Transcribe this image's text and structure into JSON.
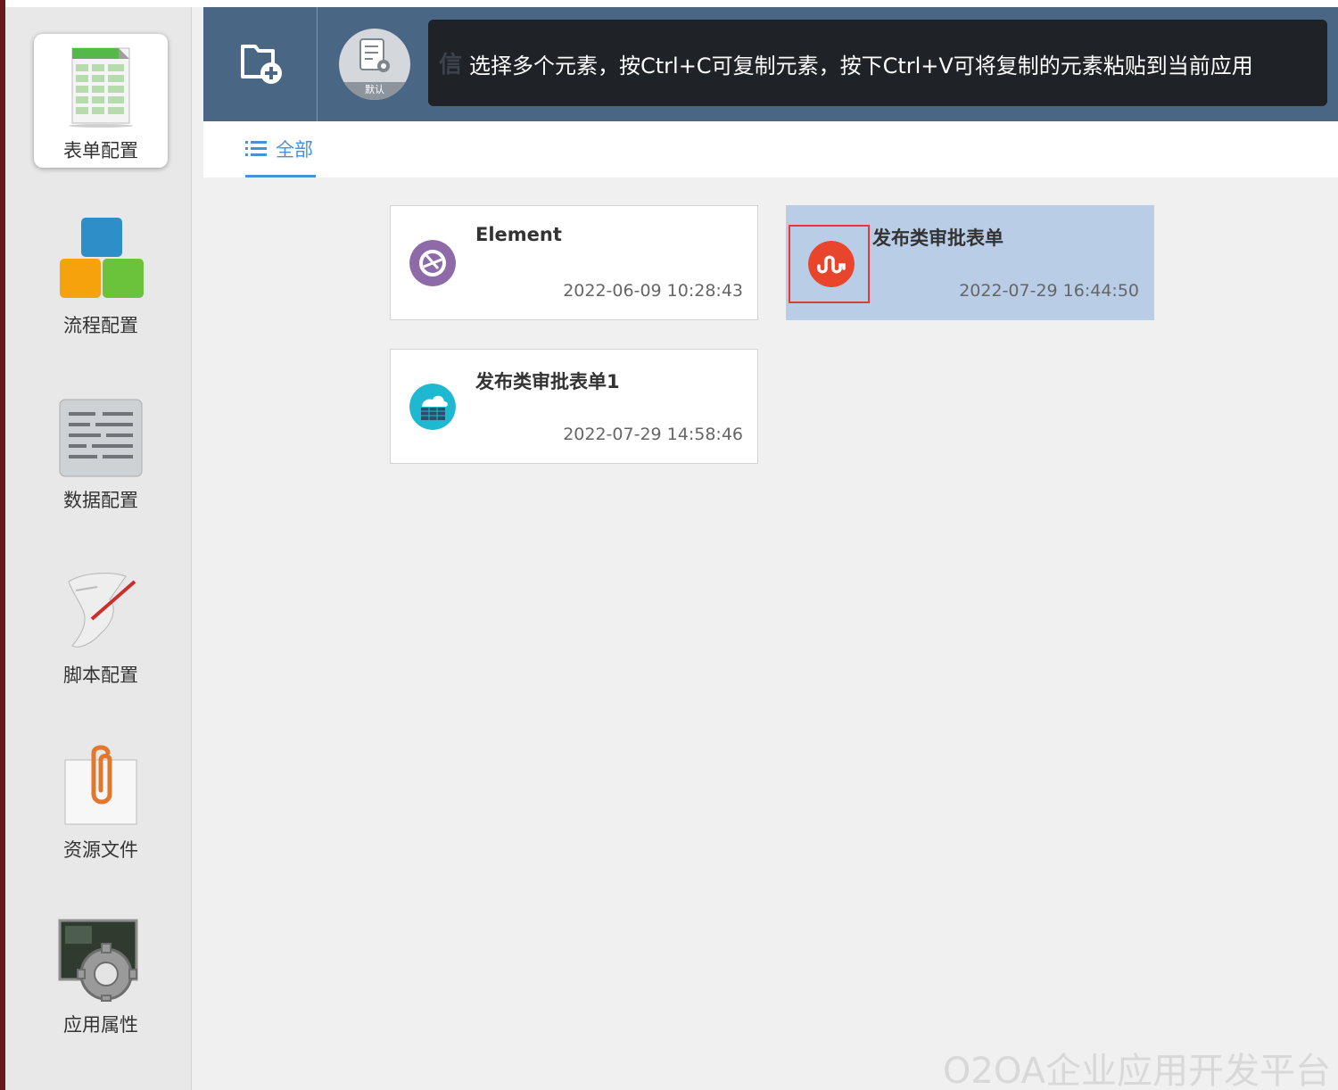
{
  "sidebar": {
    "items": [
      {
        "label": "表单配置",
        "icon": "form-spreadsheet-icon",
        "active": true
      },
      {
        "label": "流程配置",
        "icon": "process-blocks-icon",
        "active": false
      },
      {
        "label": "数据配置",
        "icon": "data-keyboard-icon",
        "active": false
      },
      {
        "label": "脚本配置",
        "icon": "script-scroll-icon",
        "active": false
      },
      {
        "label": "资源文件",
        "icon": "paperclip-file-icon",
        "active": false
      },
      {
        "label": "应用属性",
        "icon": "gear-settings-icon",
        "active": false
      }
    ]
  },
  "topbar": {
    "add_icon": "add-folder-icon",
    "default_chip_label": "默认",
    "tooltip_ghost": "信",
    "tooltip_text": "选择多个元素，按Ctrl+C可复制元素，按下Ctrl+V可将复制的元素粘贴到当前应用"
  },
  "tabs": {
    "all_label": "全部"
  },
  "cards": [
    {
      "title": "Element",
      "date": "2022-06-09 10:28:43",
      "icon_color": "#8e6aa8",
      "icon": "aperture-icon",
      "selected": false
    },
    {
      "title": "发布类审批表单",
      "date": "2022-07-29 16:44:50",
      "icon_color": "#e8452c",
      "icon": "stumbleupon-icon",
      "selected": true
    },
    {
      "title": "发布类审批表单1",
      "date": "2022-07-29 14:58:46",
      "icon_color": "#1fb8d1",
      "icon": "cloud-server-icon",
      "selected": false
    }
  ],
  "watermark": "O2OA企业应用开发平台"
}
